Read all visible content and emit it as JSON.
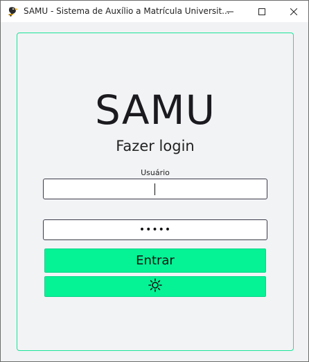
{
  "window": {
    "title": "SAMU - Sistema de Auxílio a Matrícula Universit..."
  },
  "login": {
    "app_name": "SAMU",
    "heading": "Fazer login",
    "username_label": "Usuário",
    "username_value": "",
    "password_value": "•••••",
    "enter_button": "Entrar"
  },
  "icons": {
    "app": "bird-logo-icon",
    "minimize": "minimize-icon",
    "maximize": "maximize-icon",
    "close": "close-icon",
    "theme": "sun-icon"
  },
  "colors": {
    "accent": "#05f295",
    "card_border": "#19e598"
  }
}
